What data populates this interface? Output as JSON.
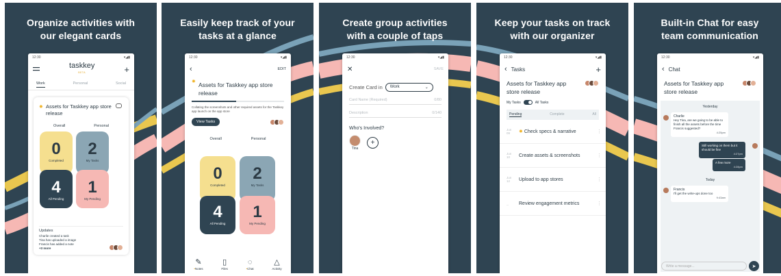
{
  "colors": {
    "panel_bg": "#2f4452",
    "yellow": "#f5df8f",
    "blue": "#8ba6b4",
    "pink": "#f6b8b4",
    "accent": "#f0b429"
  },
  "status_time": "12:30",
  "panels": [
    {
      "caption": [
        "Organize activities with",
        "our elegant cards"
      ],
      "app": {
        "logo": "taskkey",
        "beta": "BETA",
        "tabs": [
          "Work",
          "Personal",
          "Social"
        ]
      },
      "card": {
        "title": "Assets for Taskkey app store release",
        "col_overall": "Overall",
        "col_personal": "Personal",
        "tiles": [
          {
            "num": "0",
            "label": "Completed"
          },
          {
            "num": "2",
            "label": "My Tasks"
          },
          {
            "num": "4",
            "label": "All Pending"
          },
          {
            "num": "1",
            "label": "My Pending"
          }
        ],
        "updates_head": "Updates",
        "updates": [
          "Charlie created a task",
          "Tina has uploaded a image",
          "Francis has added a note"
        ],
        "more": "+3 more"
      }
    },
    {
      "caption": [
        "Easily keep track of your",
        "tasks at a glance"
      ],
      "edit": "EDIT",
      "title": "Assets for Taskkey app store release",
      "progress": 0.48,
      "desc": "Collating the screenshots and other required assets for the Taskkey app launch on the app store",
      "view_tasks": "View Tasks",
      "col_overall": "Overall",
      "col_personal": "Personal",
      "tiles": [
        {
          "num": "0",
          "label": "Completed"
        },
        {
          "num": "2",
          "label": "My Tasks"
        },
        {
          "num": "4",
          "label": "All Pending"
        },
        {
          "num": "1",
          "label": "My Pending"
        }
      ],
      "nav": [
        "Notes",
        "Files",
        "Chat",
        "Activity"
      ]
    },
    {
      "caption": [
        "Create group activities",
        "with a couple of taps"
      ],
      "save": "SAVE",
      "create_in": "Create Card in",
      "select_value": "Work",
      "card_name_ph": "Card Name (Required)",
      "card_name_count": "0/80",
      "desc_ph": "Description",
      "desc_count": "0/140",
      "who": "Who's Involved?",
      "person": "Tina"
    },
    {
      "caption": [
        "Keep your tasks on track",
        "with our organizer"
      ],
      "header": "Tasks",
      "title": "Assets for Taskkey app store release",
      "my_tasks": "My Tasks",
      "all_tasks": "All Tasks",
      "subtabs": [
        "Pending",
        "Complete",
        "All"
      ],
      "tasks": [
        {
          "date": [
            "Jun",
            "09"
          ],
          "name": "Check specs & narrative"
        },
        {
          "date": [
            "Jun",
            "10"
          ],
          "name": "Create assets & screenshots"
        },
        {
          "date": [
            "Jun",
            "12"
          ],
          "name": "Upload to app stores"
        },
        {
          "date": [
            "",
            "--"
          ],
          "name": "Review engagement metrics"
        }
      ]
    },
    {
      "caption": [
        "Built-in Chat for easy",
        "team communication"
      ],
      "header": "Chat",
      "title": "Assets for Taskkey app store release",
      "yesterday": "Yesterday",
      "today": "Today",
      "messages": [
        {
          "name": "Charlie",
          "text": "Hey Tina, are we going to be able to finish all the assets before the time Francis suggested?",
          "time": "4:25pm"
        },
        {
          "text": "Still working on them but it should be fine",
          "time": "4:27pm"
        },
        {
          "text": "A few more",
          "time": "4:28pm"
        },
        {
          "name": "Francis",
          "text": "I'll get the write-ups done too",
          "time": "9:43am"
        }
      ],
      "compose_ph": "Write a message..."
    }
  ]
}
